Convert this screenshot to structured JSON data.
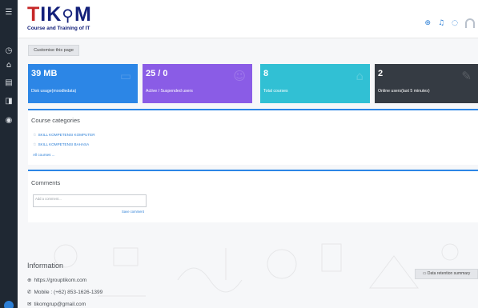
{
  "rail": {
    "icons": [
      "menu-icon",
      "dashboard-icon",
      "home-icon",
      "calendar-icon",
      "files-icon",
      "courses-icon"
    ]
  },
  "header": {
    "logo": {
      "main_t": "T",
      "main_rest": "IK",
      "main_m": "M",
      "sub": "Course and Training of IT"
    },
    "icons": [
      "globe-icon",
      "bell-icon",
      "chat-icon",
      "user-avatar"
    ]
  },
  "customise": {
    "label": "Customise this page"
  },
  "cards": [
    {
      "value": "39 MB",
      "label": "Disk usage(moodledata)",
      "icon": "files-icon",
      "color": "#2c86e6"
    },
    {
      "value": "25 / 0",
      "label": "Active / Suspended users",
      "icon": "user-icon",
      "color": "#8a5ce6"
    },
    {
      "value": "8",
      "label": "Total courses",
      "icon": "graduation-cap-icon",
      "color": "#31c0d4"
    },
    {
      "value": "2",
      "label": "Online users(last 5 minutes)",
      "icon": "pencil-icon",
      "color": "#353b43"
    }
  ],
  "course_categories": {
    "title": "Course categories",
    "items": [
      {
        "label": "SKILL KOMPETENSI KOMPUTER"
      },
      {
        "label": "SKILL KOMPETENSI BAHASA"
      }
    ],
    "all_courses": "All courses ..."
  },
  "comments": {
    "title": "Comments",
    "placeholder": "Add a comment...",
    "save": "Save comment"
  },
  "information": {
    "title": "Information",
    "website": "https://grouptikom.com",
    "mobile": "Mobile : (+62) 853-1626-1399",
    "email": "tikomgrup@gmail.com"
  },
  "retention": {
    "label": "Data retention summary"
  }
}
